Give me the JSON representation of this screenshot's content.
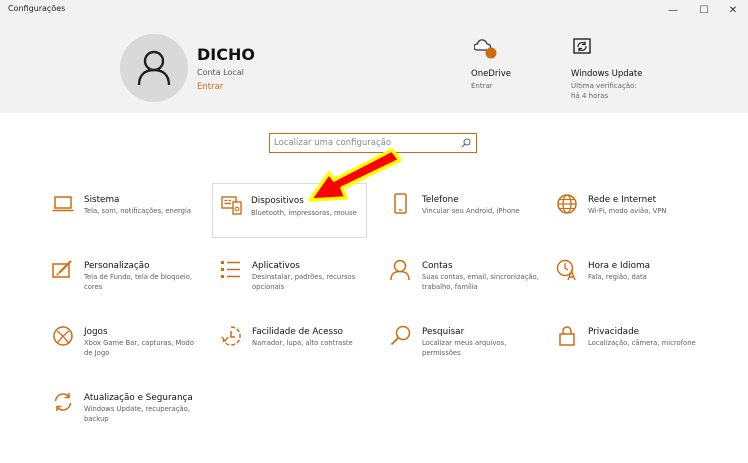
{
  "window": {
    "title": "Configurações",
    "minimize": "—",
    "maximize": "☐",
    "close": "✕"
  },
  "account": {
    "name": "DICHO",
    "type": "Conta Local",
    "link": "Entrar"
  },
  "onedrive": {
    "title": "OneDrive",
    "sub": "Entrar"
  },
  "windows_update": {
    "title": "Windows Update",
    "sub1": "Última verificação:",
    "sub2": "há 4 horas"
  },
  "search": {
    "placeholder": "Localizar uma configuração"
  },
  "accent_color": "#d06b10",
  "highlight_arrow_color": "#ff0000",
  "tiles": [
    {
      "name": "Sistema",
      "desc": "Tela, som, notificações, energia",
      "icon": "laptop-icon"
    },
    {
      "name": "Dispositivos",
      "desc": "Bluetooth, impressoras, mouse",
      "icon": "devices-icon"
    },
    {
      "name": "Telefone",
      "desc": "Vincular seu Android, iPhone",
      "icon": "phone-icon"
    },
    {
      "name": "Rede e Internet",
      "desc": "Wi-Fi, modo avião, VPN",
      "icon": "globe-icon"
    },
    {
      "name": "Personalização",
      "desc": "Tela de Fundo, tela de bloqueio, cores",
      "icon": "paint-icon"
    },
    {
      "name": "Aplicativos",
      "desc": "Desinstalar, padrões, recursos opcionais",
      "icon": "apps-list-icon"
    },
    {
      "name": "Contas",
      "desc": "Suas contas, email, sincronização, trabalho, família",
      "icon": "person-icon"
    },
    {
      "name": "Hora e Idioma",
      "desc": "Fala, região, data",
      "icon": "time-language-icon"
    },
    {
      "name": "Jogos",
      "desc": "Xbox Game Bar, capturas, Modo de Jogo",
      "icon": "xbox-icon"
    },
    {
      "name": "Facilidade de Acesso",
      "desc": "Narrador, lupa, alto contraste",
      "icon": "accessibility-icon"
    },
    {
      "name": "Pesquisar",
      "desc": "Localizar meus arquivos, permissões",
      "icon": "search-icon"
    },
    {
      "name": "Privacidade",
      "desc": "Localização, câmera, microfone",
      "icon": "lock-icon"
    },
    {
      "name": "Atualização e Segurança",
      "desc": "Windows Update, recuperação, backup",
      "icon": "sync-icon"
    }
  ]
}
